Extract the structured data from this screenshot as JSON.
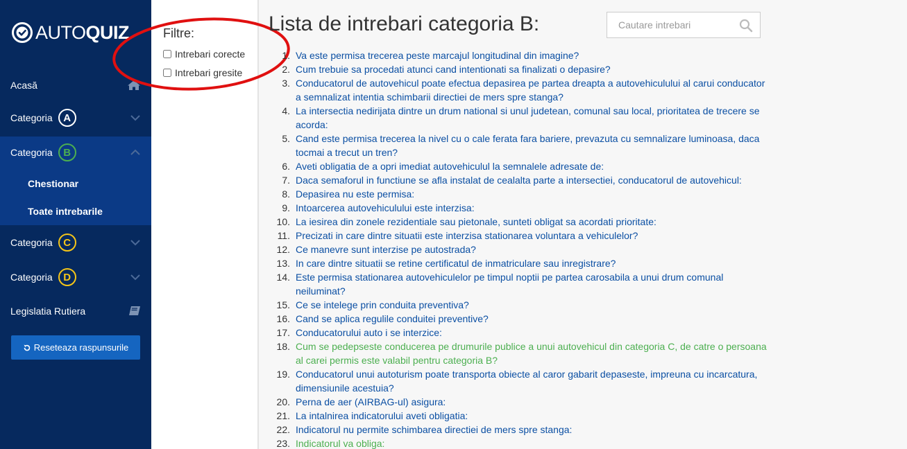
{
  "logo": {
    "auto": "AUTO",
    "quiz": "QUIZ"
  },
  "sidebar": {
    "home_label": "Acasă",
    "category_label": "Categoria",
    "categories": [
      {
        "letter": "A",
        "color": "#ffffff"
      },
      {
        "letter": "B",
        "color": "#4caf50"
      },
      {
        "letter": "C",
        "color": "#f5c518"
      },
      {
        "letter": "D",
        "color": "#f5c518"
      }
    ],
    "sub_items": [
      "Chestionar",
      "Toate intrebarile"
    ],
    "legislation_label": "Legislatia Rutiera",
    "reset_label": "Reseteaza raspunsurile"
  },
  "filters": {
    "title": "Filtre:",
    "correct_label": "Intrebari corecte",
    "wrong_label": "Intrebari gresite"
  },
  "main": {
    "title": "Lista de intrebari categoria B:",
    "search_placeholder": "Cautare intrebari"
  },
  "questions": [
    {
      "n": "1.",
      "text": "Va este permisa trecerea peste marcajul longitudinal din imagine?",
      "status": "normal"
    },
    {
      "n": "2.",
      "text": "Cum trebuie sa procedati atunci cand intentionati sa finalizati o depasire?",
      "status": "normal"
    },
    {
      "n": "3.",
      "text": "Conducatorul de autovehicul poate efectua depasirea pe partea dreapta a autovehiculului al carui conducator a semnalizat intentia schimbarii directiei de mers spre stanga?",
      "status": "normal"
    },
    {
      "n": "4.",
      "text": "La intersectia nedirijata dintre un drum national si unul judetean, comunal sau local, prioritatea de trecere se acorda:",
      "status": "normal"
    },
    {
      "n": "5.",
      "text": "Cand este permisa trecerea la nivel cu o cale ferata fara bariere, prevazuta cu semnalizare luminoasa, daca tocmai a trecut un tren?",
      "status": "normal"
    },
    {
      "n": "6.",
      "text": "Aveti obligatia de a opri imediat autovehiculul la semnalele adresate de:",
      "status": "normal"
    },
    {
      "n": "7.",
      "text": "Daca semaforul in functiune se afla instalat de cealalta parte a intersectiei, conducatorul de autovehicul:",
      "status": "normal"
    },
    {
      "n": "8.",
      "text": "Depasirea nu este permisa:",
      "status": "normal"
    },
    {
      "n": "9.",
      "text": "Intoarcerea autovehiculului este interzisa:",
      "status": "normal"
    },
    {
      "n": "10.",
      "text": "La iesirea din zonele rezidentiale sau pietonale, sunteti obligat sa acordati prioritate:",
      "status": "normal"
    },
    {
      "n": "11.",
      "text": "Precizati in care dintre situatii este interzisa stationarea voluntara a vehiculelor?",
      "status": "normal"
    },
    {
      "n": "12.",
      "text": "Ce manevre sunt interzise pe autostrada?",
      "status": "normal"
    },
    {
      "n": "13.",
      "text": "In care dintre situatii se retine certificatul de inmatriculare sau inregistrare?",
      "status": "normal"
    },
    {
      "n": "14.",
      "text": "Este permisa stationarea autovehiculelor pe timpul noptii pe partea carosabila a unui drum comunal neiluminat?",
      "status": "normal"
    },
    {
      "n": "15.",
      "text": "Ce se intelege prin conduita preventiva?",
      "status": "normal"
    },
    {
      "n": "16.",
      "text": "Cand se aplica regulile conduitei preventive?",
      "status": "normal"
    },
    {
      "n": "17.",
      "text": "Conducatorului auto i se interzice:",
      "status": "normal"
    },
    {
      "n": "18.",
      "text": "Cum se pedepseste conducerea pe drumurile publice a unui autovehicul din categoria C, de catre o persoana al carei permis este valabil pentru categoria B?",
      "status": "correct"
    },
    {
      "n": "19.",
      "text": "Conducatorul unui autoturism poate transporta obiecte al caror gabarit depaseste, impreuna cu incarcatura, dimensiunile acestuia?",
      "status": "normal"
    },
    {
      "n": "20.",
      "text": "Perna de aer (AIRBAG-ul) asigura:",
      "status": "normal"
    },
    {
      "n": "21.",
      "text": "La intalnirea indicatorului aveti obligatia:",
      "status": "normal"
    },
    {
      "n": "22.",
      "text": "Indicatorul nu permite schimbarea directiei de mers spre stanga:",
      "status": "normal"
    },
    {
      "n": "23.",
      "text": "Indicatorul va obliga:",
      "status": "correct"
    }
  ]
}
